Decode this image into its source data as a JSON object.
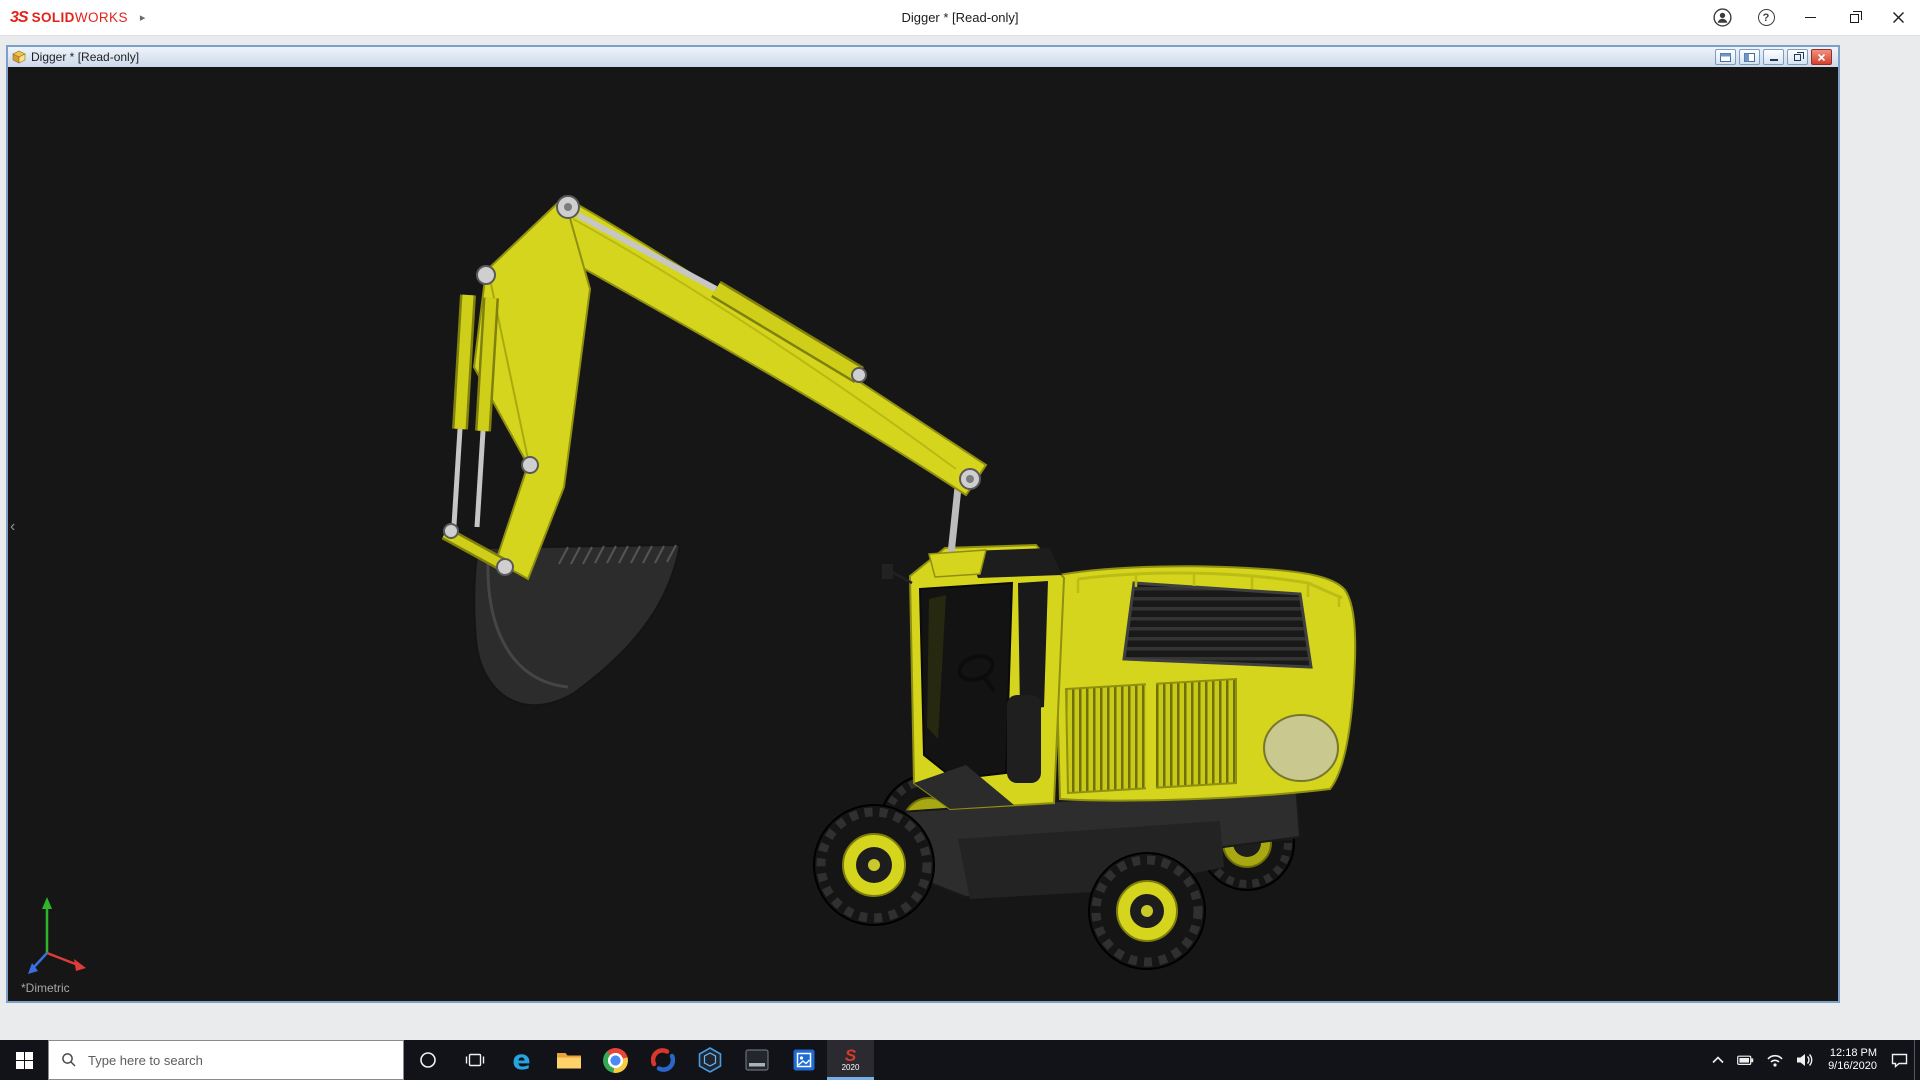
{
  "colors": {
    "digger_yellow": "#d6d51d",
    "digger_yellow_dark": "#8f8f10",
    "viewport_bg": "#161616",
    "taskbar_bg": "#121219",
    "titlebar_bg": "#ffffff",
    "child_border": "#7ea0c8",
    "close_red": "#d5402c",
    "brand_red": "#e2231a",
    "accent_blue": "#0078d7"
  },
  "app_titlebar": {
    "logo_3s": "3S",
    "logo_solid": "SOLID",
    "logo_works": "WORKS",
    "logo_arrow": "▸",
    "help_glyph": "?",
    "title": "Digger * [Read-only]"
  },
  "doc_window": {
    "title": "Digger * [Read-only]"
  },
  "viewport": {
    "orientation": "*Dimetric",
    "collapse_arrow": "‹"
  },
  "taskbar": {
    "search_placeholder": "Type here to search",
    "edge_glyph": "e",
    "sw_glyph": "S",
    "sw_badge": "2020",
    "time": "12:18 PM",
    "date": "9/16/2020"
  }
}
